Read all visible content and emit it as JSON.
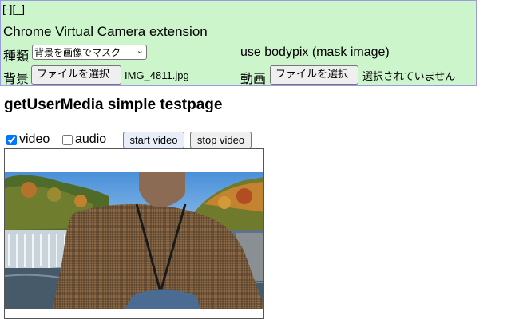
{
  "window_controls": "[-][_]",
  "extension": {
    "title": "Chrome Virtual Camera extension",
    "kind_label": "種類",
    "kind_select_value": "背景を画像でマスク",
    "mode_description": "use bodypix (mask image)",
    "background_label": "背景",
    "background_button": "ファイルを選択",
    "background_file": "IMG_4811.jpg",
    "video_label": "動画",
    "video_button": "ファイルを選択",
    "video_file": "選択されていません"
  },
  "page": {
    "title": "getUserMedia simple testpage",
    "video_option": "video",
    "video_checked": true,
    "audio_option": "audio",
    "audio_checked": false,
    "start_button": "start video",
    "stop_button": "stop video"
  },
  "colors": {
    "panel_bg": "#ccf5cc",
    "panel_border": "#9b9be6"
  }
}
